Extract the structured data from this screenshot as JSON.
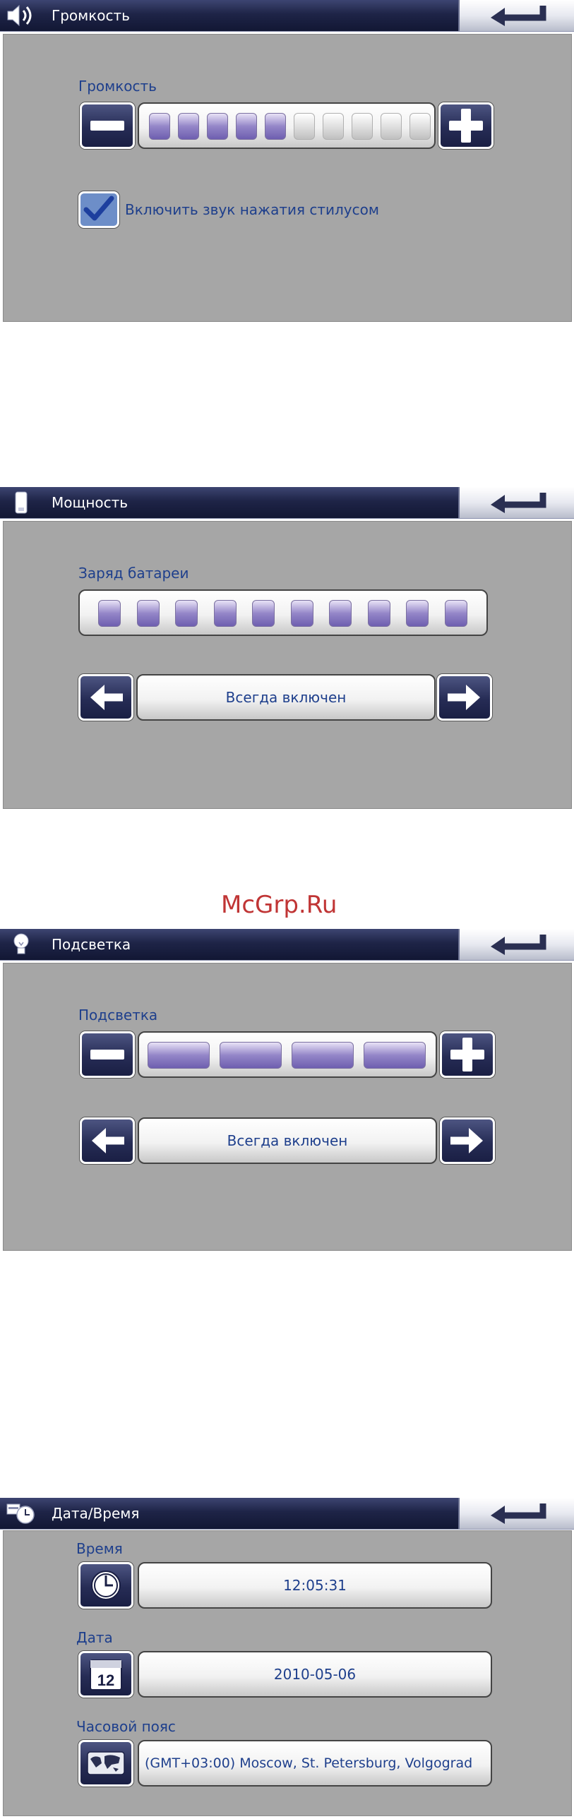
{
  "colors": {
    "title_bar": "#1e2447",
    "panel": "#a6a6a6",
    "label_text": "#1e3f8c",
    "level_on": "#8072bc",
    "watermark": "#c03535"
  },
  "volume": {
    "title": "Громкость",
    "title_icon": "speaker-icon",
    "label": "Громкость",
    "level": 5,
    "level_max": 10,
    "checkbox_checked": true,
    "checkbox_label": "Включить звук нажатия стилусом"
  },
  "power": {
    "title": "Мощность",
    "title_icon": "battery-icon",
    "label": "Заряд батареи",
    "level": 10,
    "level_max": 10,
    "mode": "Всегда включен"
  },
  "watermark": "McGrp.Ru",
  "backlight": {
    "title": "Подсветка",
    "title_icon": "light-bulb-icon",
    "label": "Подсветка",
    "level": 4,
    "level_max": 4,
    "mode": "Всегда включен"
  },
  "datetime": {
    "title": "Дата/Время",
    "title_icon": "calendar-clock-icon",
    "time_label": "Время",
    "time_value": "12:05:31",
    "date_label": "Дата",
    "date_value": "2010-05-06",
    "calendar_day": "12",
    "tz_label": "Часовой пояс",
    "tz_value": "(GMT+03:00) Moscow, St. Petersburg, Volgograd"
  }
}
